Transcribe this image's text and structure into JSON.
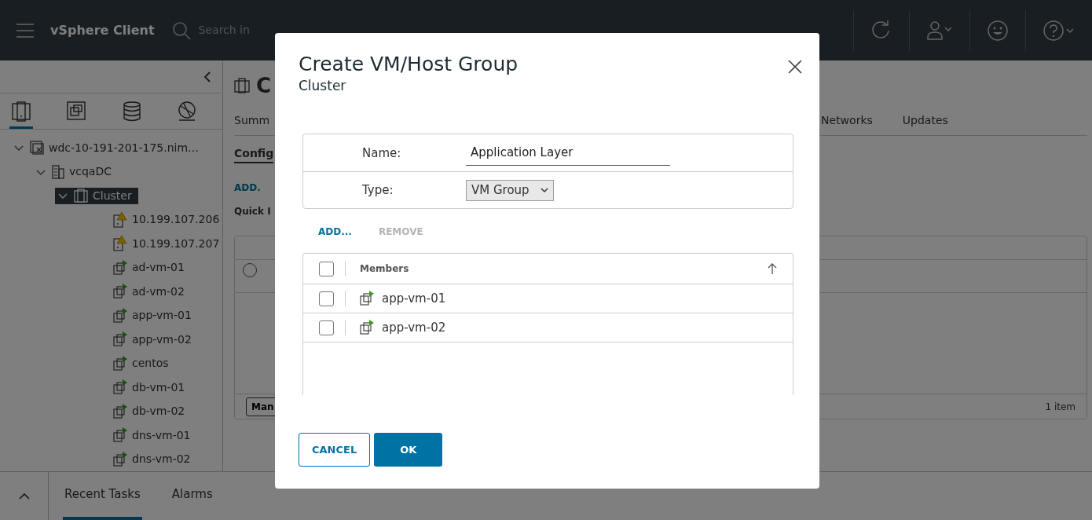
{
  "top_bar": {
    "app_title": "vSphere Client",
    "search_placeholder": "Search in"
  },
  "sidebar": {
    "view_tabs": [
      {
        "kind": "hosts",
        "selected": true
      },
      {
        "kind": "vms",
        "selected": false
      },
      {
        "kind": "storage",
        "selected": false
      },
      {
        "kind": "network",
        "selected": false
      }
    ],
    "tree": [
      {
        "label": "wdc-10-191-201-175.nim…",
        "kind": "vcenter",
        "expanded": true,
        "selected": false,
        "children": [
          {
            "label": "vcqaDC",
            "kind": "datacenter",
            "expanded": true,
            "selected": false,
            "children": [
              {
                "label": "Cluster",
                "kind": "cluster",
                "expanded": true,
                "selected": true,
                "children": [
                  {
                    "label": "10.199.107.206",
                    "kind": "host",
                    "selected": false
                  },
                  {
                    "label": "10.199.107.207",
                    "kind": "host",
                    "selected": false
                  },
                  {
                    "label": "ad-vm-01",
                    "kind": "vm",
                    "selected": false
                  },
                  {
                    "label": "ad-vm-02",
                    "kind": "vm",
                    "selected": false
                  },
                  {
                    "label": "app-vm-01",
                    "kind": "vm",
                    "selected": false
                  },
                  {
                    "label": "app-vm-02",
                    "kind": "vm",
                    "selected": false
                  },
                  {
                    "label": "centos",
                    "kind": "vm",
                    "selected": false
                  },
                  {
                    "label": "db-vm-01",
                    "kind": "vm",
                    "selected": false
                  },
                  {
                    "label": "db-vm-02",
                    "kind": "vm",
                    "selected": false
                  },
                  {
                    "label": "dns-vm-01",
                    "kind": "vm",
                    "selected": false
                  },
                  {
                    "label": "dns-vm-02",
                    "kind": "vm",
                    "selected": false
                  }
                ]
              }
            ]
          }
        ]
      }
    ]
  },
  "main": {
    "title": "C",
    "tabs": [
      {
        "label": "Summ",
        "selected": false
      },
      {
        "label": "Networks",
        "selected": false
      },
      {
        "label": "Updates",
        "selected": false
      }
    ],
    "subtab": "Config",
    "row_radio_selected": false,
    "add_link": "ADD.",
    "filter_label": "Quick I",
    "manage_button": "Man",
    "footer_count": "1 item"
  },
  "dialog": {
    "title": "Create VM/Host Group",
    "subtitle": "Cluster",
    "name_label": "Name:",
    "name_value": "Application Layer",
    "type_label": "Type:",
    "type_value": "VM Group",
    "add_button": "ADD...",
    "remove_button": "REMOVE",
    "remove_disabled": true,
    "members_header": "Members",
    "select_all_checked": false,
    "members": [
      {
        "name": "app-vm-01",
        "checked": false
      },
      {
        "name": "app-vm-02",
        "checked": false
      }
    ],
    "cancel_button": "CANCEL",
    "ok_button": "OK"
  },
  "bottom_panel": {
    "tabs": [
      {
        "label": "Recent Tasks",
        "selected": true
      },
      {
        "label": "Alarms",
        "selected": false
      }
    ]
  }
}
